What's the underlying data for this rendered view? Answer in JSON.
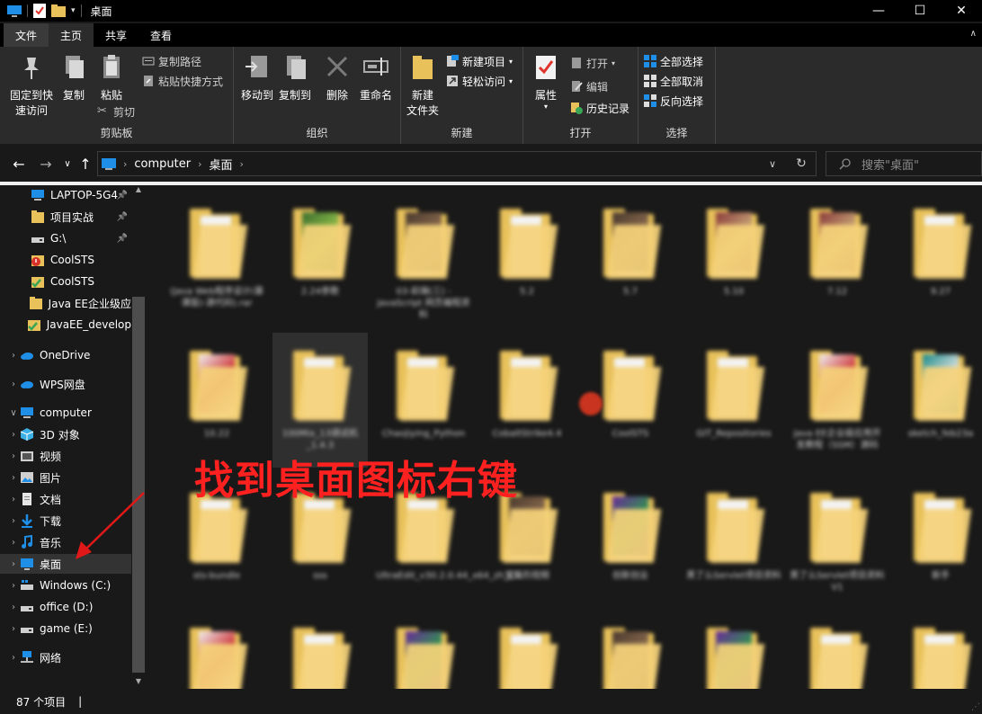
{
  "window": {
    "title": "桌面",
    "controls": [
      "—",
      "☐",
      "✕"
    ]
  },
  "ribbon_tabs": [
    "文件",
    "主页",
    "共享",
    "查看"
  ],
  "ribbon": {
    "clipboard": {
      "label": "剪贴板",
      "pin": "固定到快\n速访问",
      "copy": "复制",
      "paste": "粘贴",
      "copy_path": "复制路径",
      "paste_shortcut": "粘贴快捷方式",
      "cut": "剪切"
    },
    "organize": {
      "label": "组织",
      "move_to": "移动到",
      "copy_to": "复制到",
      "delete": "删除",
      "rename": "重命名"
    },
    "new": {
      "label": "新建",
      "new_folder": "新建\n文件夹",
      "new_item": "新建项目",
      "easy_access": "轻松访问"
    },
    "open": {
      "label": "打开",
      "properties": "属性",
      "open": "打开",
      "edit": "编辑",
      "history": "历史记录"
    },
    "select": {
      "label": "选择",
      "select_all": "全部选择",
      "select_none": "全部取消",
      "invert": "反向选择"
    }
  },
  "address": {
    "crumbs": [
      "computer",
      "桌面"
    ],
    "search_placeholder": "搜索\"桌面\""
  },
  "nav_pane": [
    {
      "label": "LAPTOP-5G4",
      "icon": "computer-icon",
      "pinned": true
    },
    {
      "label": "项目实战",
      "icon": "folder-icon",
      "pinned": true
    },
    {
      "label": "G:\\",
      "icon": "drive-icon",
      "pinned": true
    },
    {
      "label": "CoolSTS",
      "icon": "error-folder-icon",
      "pinned": false
    },
    {
      "label": "CoolSTS",
      "icon": "check-folder-icon",
      "pinned": false
    },
    {
      "label": "Java EE企业级应",
      "icon": "folder-icon",
      "pinned": false
    },
    {
      "label": "JavaEE_develop",
      "icon": "check-folder-icon",
      "pinned": false
    },
    {
      "label": "OneDrive",
      "icon": "cloud-icon",
      "pinned": false
    },
    {
      "label": "WPS网盘",
      "icon": "cloud-icon",
      "pinned": false
    },
    {
      "label": "computer",
      "icon": "computer-icon",
      "pinned": false
    },
    {
      "label": "3D 对象",
      "icon": "cube-icon",
      "pinned": false
    },
    {
      "label": "视频",
      "icon": "video-icon",
      "pinned": false
    },
    {
      "label": "图片",
      "icon": "picture-icon",
      "pinned": false
    },
    {
      "label": "文档",
      "icon": "document-icon",
      "pinned": false
    },
    {
      "label": "下载",
      "icon": "download-icon",
      "pinned": false
    },
    {
      "label": "音乐",
      "icon": "music-icon",
      "pinned": false
    },
    {
      "label": "桌面",
      "icon": "desktop-icon",
      "pinned": false
    },
    {
      "label": "Windows (C:)",
      "icon": "windows-drive-icon",
      "pinned": false
    },
    {
      "label": "office (D:)",
      "icon": "drive-icon",
      "pinned": false
    },
    {
      "label": "game (E:)",
      "icon": "drive-icon",
      "pinned": false
    },
    {
      "label": "网络",
      "icon": "network-icon",
      "pinned": false
    }
  ],
  "files": [
    {
      "name": "(Java Web程序设计(慕课版)-源代码).rar",
      "kind": "folder"
    },
    {
      "name": "2.24参数",
      "kind": "photo-green"
    },
    {
      "name": "03-前端(三) - JavaScript 网页编程资料",
      "kind": "photo-dark"
    },
    {
      "name": "5.2",
      "kind": "folder"
    },
    {
      "name": "5.7",
      "kind": "photo-dark"
    },
    {
      "name": "5.10",
      "kind": "photo-mixed"
    },
    {
      "name": "7.12",
      "kind": "photo-mixed"
    },
    {
      "name": "9.27",
      "kind": "folder"
    },
    {
      "name": "10.22",
      "kind": "photo-red"
    },
    {
      "name": "100Mix_13调试机_1.4.3",
      "kind": "folder"
    },
    {
      "name": "Chaojiying_Python",
      "kind": "folder"
    },
    {
      "name": "CobaltStrike4.4",
      "kind": "folder"
    },
    {
      "name": "CoolSTS",
      "kind": "folder"
    },
    {
      "name": "GIT_Repositories",
      "kind": "folder"
    },
    {
      "name": "Java EE企业级应用开发教程（SSM）源码",
      "kind": "photo-red"
    },
    {
      "name": "sketch_feb23a",
      "kind": "photo-teal"
    },
    {
      "name": "sts-bundle",
      "kind": "folder"
    },
    {
      "name": "sss",
      "kind": "folder"
    },
    {
      "name": "UltraEdit_v30.2.0.44_x64_zh_CN",
      "kind": "folder"
    },
    {
      "name": "宝贝的视频",
      "kind": "photo-dark"
    },
    {
      "name": "创新创业",
      "kind": "archive"
    },
    {
      "name": "黑了么Servlet项目资料",
      "kind": "folder"
    },
    {
      "name": "黑了么Servlet项目资料 V1",
      "kind": "folder"
    },
    {
      "name": "新手",
      "kind": "folder"
    },
    {
      "name": "",
      "kind": "photo-red"
    },
    {
      "name": "",
      "kind": "folder"
    },
    {
      "name": "",
      "kind": "archive"
    },
    {
      "name": "",
      "kind": "folder"
    },
    {
      "name": "",
      "kind": "photo-dark"
    },
    {
      "name": "",
      "kind": "archive"
    },
    {
      "name": "",
      "kind": "folder"
    },
    {
      "name": "",
      "kind": "folder"
    }
  ],
  "annotation": "找到桌面图标右键",
  "status": {
    "count": "87 个项目"
  },
  "colors": {
    "folder_yellow": "#e8c15a",
    "annotation_red": "#ff2020",
    "background": "#191919",
    "ribbon": "#2b2b2b"
  }
}
